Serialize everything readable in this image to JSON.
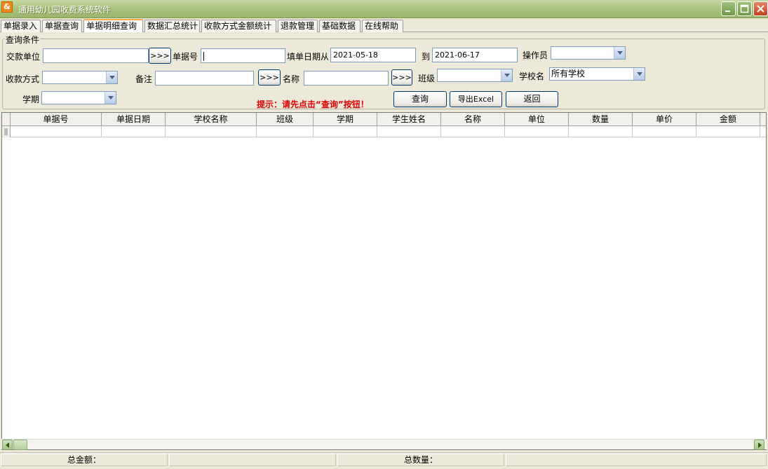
{
  "window": {
    "title": "通用幼儿园收费系统软件",
    "icon": "app-icon"
  },
  "tabs": [
    {
      "label": "单据录入"
    },
    {
      "label": "单据查询"
    },
    {
      "label": "单据明细查询"
    },
    {
      "label": "数据汇总统计"
    },
    {
      "label": "收款方式金额统计"
    },
    {
      "label": "退款管理"
    },
    {
      "label": "基础数据"
    },
    {
      "label": "在线帮助"
    }
  ],
  "query": {
    "group_title": "查询条件",
    "payer_label": "交款单位",
    "payer_value": "",
    "browse_label": ">>>",
    "receipt_no_label": "单据号",
    "receipt_no_value": "",
    "date_from_label": "填单日期从",
    "date_from": "2021-05-18",
    "date_to_label": "到",
    "date_to": "2021-06-17",
    "operator_label": "操作员",
    "operator_value": "",
    "payment_method_label": "收款方式",
    "payment_method_value": "",
    "remark_label": "备注",
    "remark_value": "",
    "name_label": "名称",
    "name_value": "",
    "class_label": "班级",
    "class_value": "",
    "school_label": "学校名",
    "school_value": "所有学校",
    "term_label": "学期",
    "term_value": "",
    "hint": "提示：请先点击“查询”按钮！",
    "query_button": "查询",
    "export_button": "导出Excel",
    "back_button": "返回"
  },
  "grid": {
    "columns": [
      "单据号",
      "单据日期",
      "学校名称",
      "班级",
      "学期",
      "学生姓名",
      "名称",
      "单位",
      "数量",
      "单价",
      "金额"
    ],
    "rows": []
  },
  "statusbar": {
    "total_amount_label": "总金额：",
    "total_amount_value": "",
    "total_qty_label": "总数量：",
    "total_qty_value": ""
  }
}
